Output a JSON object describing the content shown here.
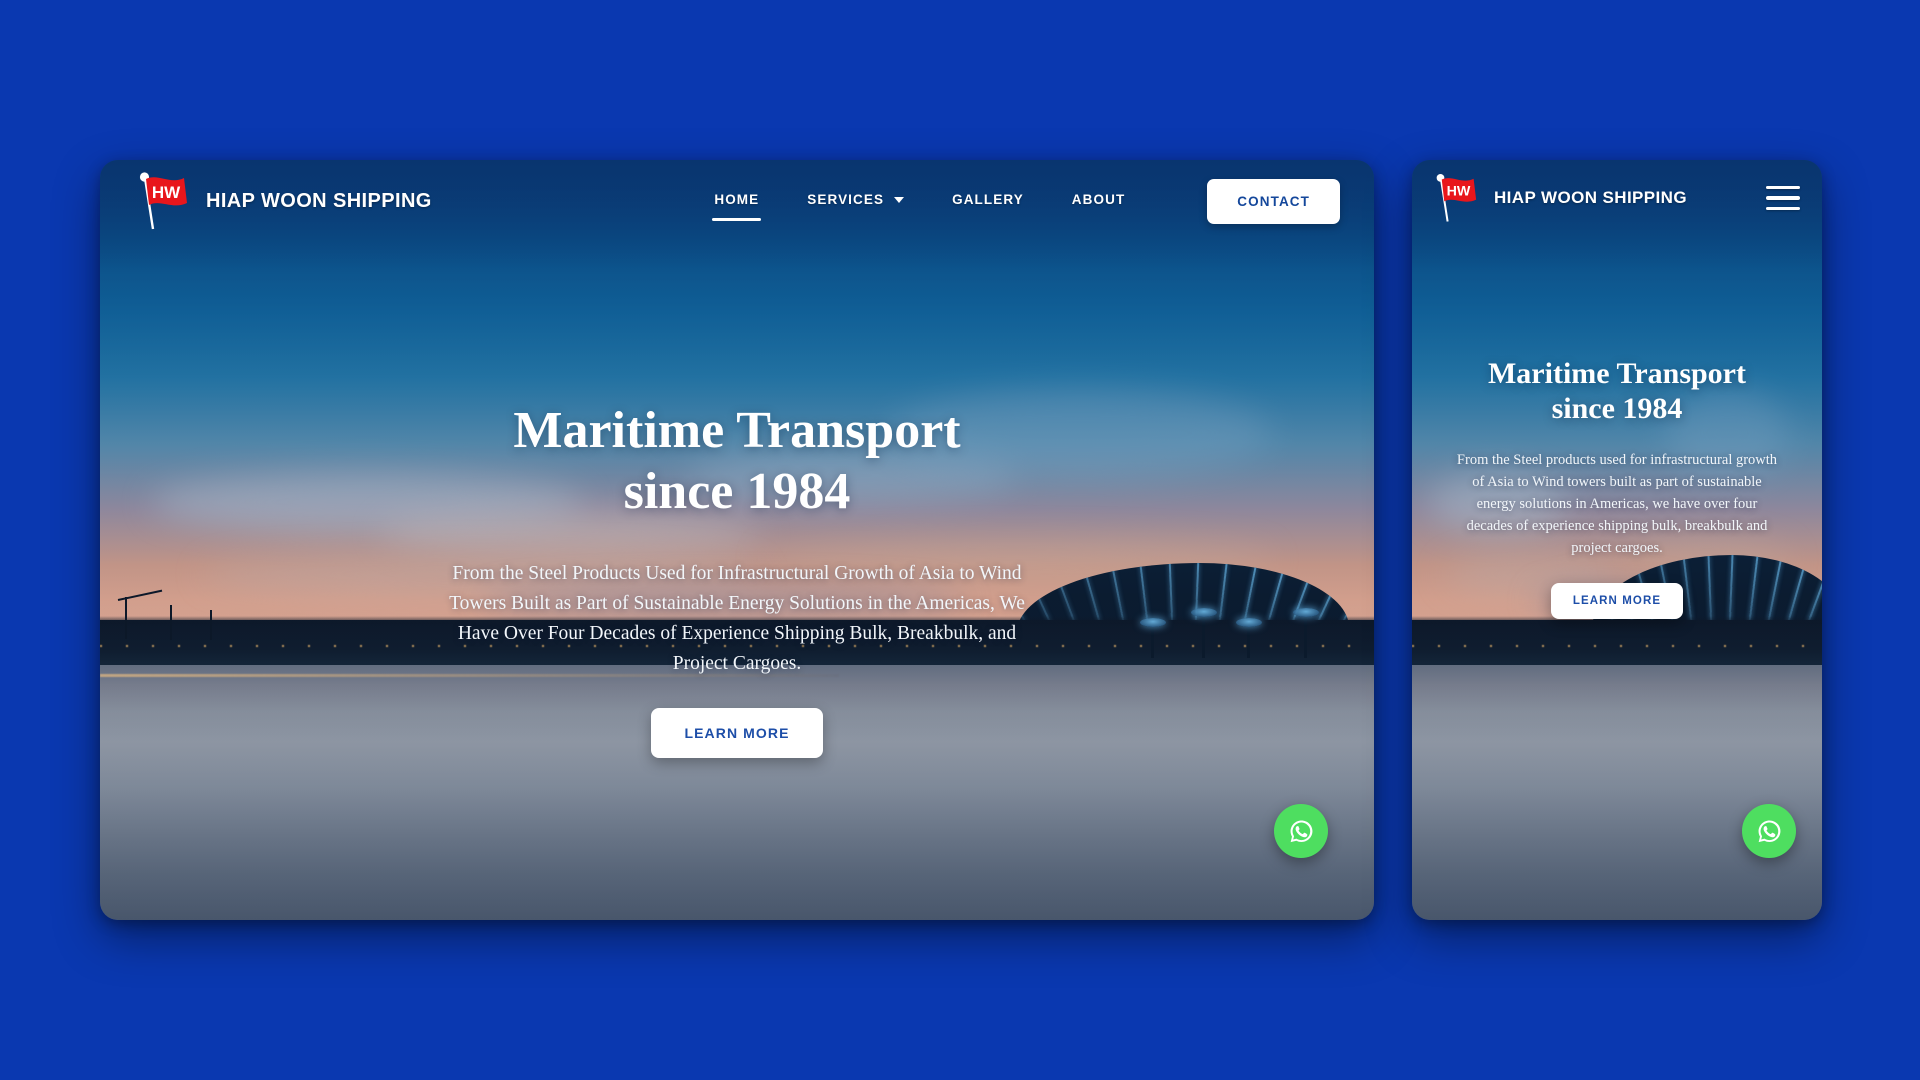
{
  "page": {
    "background_color": "#0a38b0",
    "accent_blue": "#14479b",
    "logo_red": "#e8161c",
    "whatsapp_green": "#4ede60"
  },
  "brand": {
    "logo_icon": "hw-flag-logo",
    "logo_initials": "HW",
    "name": "HIAP WOON SHIPPING"
  },
  "desktop": {
    "nav": {
      "items": [
        {
          "label": "HOME",
          "active": true,
          "has_dropdown": false
        },
        {
          "label": "SERVICES",
          "active": false,
          "has_dropdown": true
        },
        {
          "label": "GALLERY",
          "active": false,
          "has_dropdown": false
        },
        {
          "label": "ABOUT",
          "active": false,
          "has_dropdown": false
        }
      ],
      "contact_label": "CONTACT",
      "dropdown_icon": "chevron-down-icon"
    },
    "hero": {
      "title_line1": "Maritime Transport",
      "title_line2": "since 1984",
      "subtitle": "From the Steel Products Used for Infrastructural Growth of Asia to Wind Towers Built as Part of Sustainable Energy Solutions in the Americas, We Have Over Four Decades of Experience Shipping Bulk, Breakbulk, and Project Cargoes.",
      "cta_label": "LEARN MORE"
    },
    "whatsapp_icon": "whatsapp-icon"
  },
  "mobile": {
    "nav": {
      "menu_icon": "hamburger-menu-icon"
    },
    "hero": {
      "title_line1": "Maritime Transport",
      "title_line2": "since 1984",
      "subtitle": "From the Steel products used for infrastructural growth of Asia to Wind towers built as part of sustainable energy solutions in Americas, we have over four decades of experience shipping bulk, breakbulk and project cargoes.",
      "cta_label": "LEARN MORE"
    },
    "whatsapp_icon": "whatsapp-icon"
  }
}
